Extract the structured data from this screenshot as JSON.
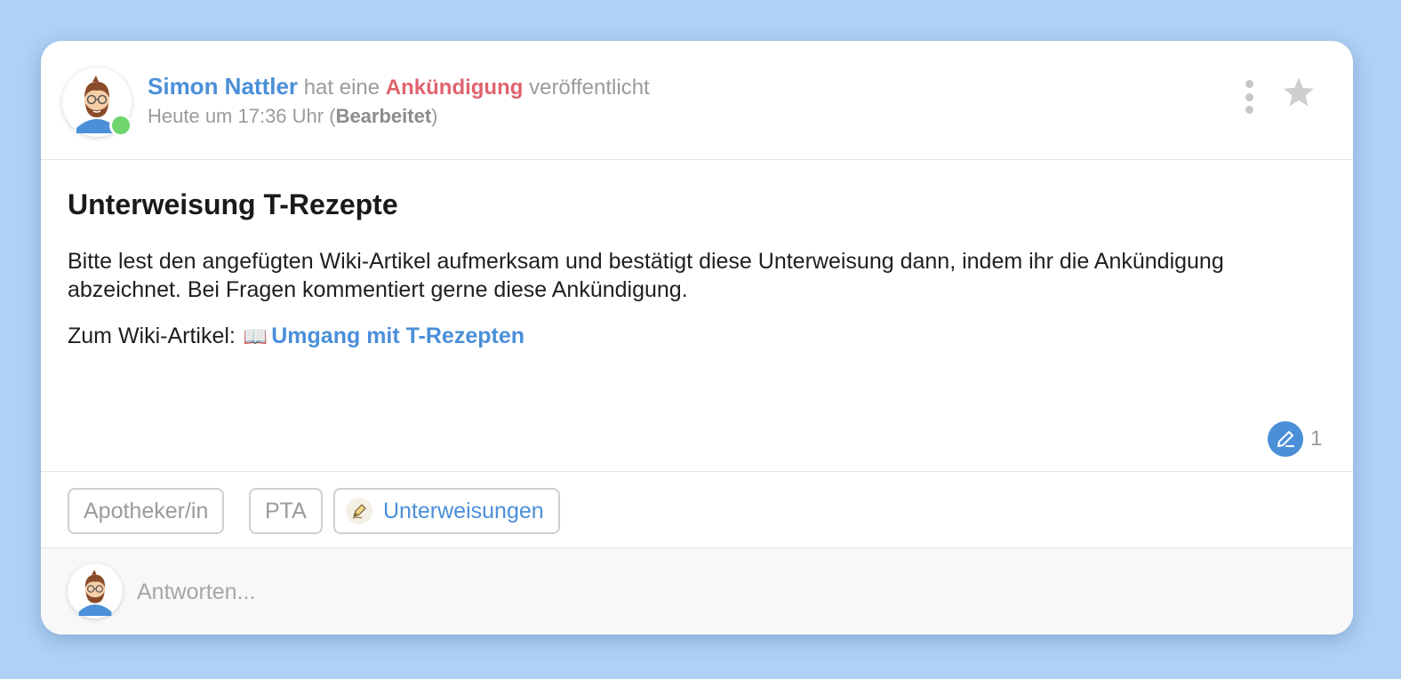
{
  "post": {
    "author": "Simon Nattler",
    "action_prefix": "hat eine",
    "type": "Ankündigung",
    "action_suffix": "veröffentlicht",
    "time": "Heute um 17:36 Uhr",
    "edited_open": "(",
    "edited": "Bearbeitet",
    "edited_close": ")",
    "author_online": true,
    "title": "Unterweisung T-Rezepte",
    "text": "Bitte lest den angefügten Wiki-Artikel aufmerksam und bestätigt diese Unterweisung dann, indem ihr die Ankündigung abzeichnet. Bei Fragen kommentiert gerne diese Ankündigung.",
    "wiki_label": "Zum Wiki-Artikel:",
    "wiki_icon": "📖",
    "wiki_link": "Umgang mit T-Rezepten",
    "signatures_count": "1"
  },
  "tags": [
    {
      "label": "Apotheker/in"
    },
    {
      "label": "PTA"
    },
    {
      "label": "Unterweisungen",
      "icon": "pen-nib-icon"
    }
  ],
  "reply": {
    "placeholder": "Antworten..."
  },
  "colors": {
    "background": "#afd1f5",
    "accent": "#4a8fd8",
    "announcement": "#e0636e",
    "online": "#6dd56b"
  }
}
